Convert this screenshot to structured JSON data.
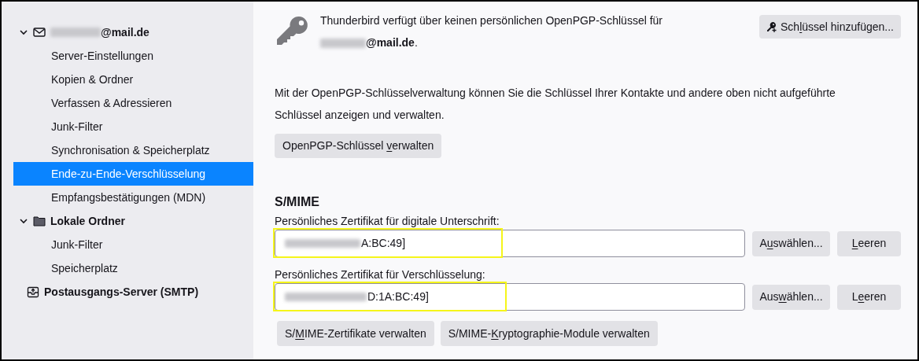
{
  "sidebar": {
    "items": [
      {
        "label": "@mail.de",
        "kind": "account",
        "expanded": true,
        "selected": false,
        "children": [
          {
            "label": "Server-Einstellungen",
            "selected": false
          },
          {
            "label": "Kopien & Ordner",
            "selected": false
          },
          {
            "label": "Verfassen & Adressieren",
            "selected": false
          },
          {
            "label": "Junk-Filter",
            "selected": false
          },
          {
            "label": "Synchronisation & Speicherplatz",
            "selected": false
          },
          {
            "label": "Ende-zu-Ende-Verschlüsselung",
            "selected": true
          },
          {
            "label": "Empfangsbestätigungen (MDN)",
            "selected": false
          }
        ]
      },
      {
        "label": "Lokale Ordner",
        "kind": "folder",
        "expanded": true,
        "selected": false,
        "children": [
          {
            "label": "Junk-Filter",
            "selected": false
          },
          {
            "label": "Speicherplatz",
            "selected": false
          }
        ]
      },
      {
        "label": "Postausgangs-Server (SMTP)",
        "kind": "outbox",
        "selected": false
      }
    ]
  },
  "openpgp": {
    "message": "Thunderbird verfügt über keinen persönlichen OpenPGP-Schlüssel für",
    "account": "**@mail.de**.",
    "add_button": {
      "label": [
        {
          "text": "Sch",
          "underlined": false
        },
        {
          "text": "l",
          "underlined": true
        },
        {
          "text": "üssel hinzufügen...",
          "underlined": false
        }
      ]
    },
    "info": "Mit der OpenPGP-Schlüsselverwaltung können Sie die Schlüssel Ihrer Kontakte und andere oben nicht aufgeführte Schlüssel anzeigen und verwalten.",
    "manage_button": {
      "label": [
        {
          "text": "OpenPGP-Schlüssel ",
          "underlined": false
        },
        {
          "text": "v",
          "underlined": true
        },
        {
          "text": "erwalten",
          "underlined": false
        }
      ]
    }
  },
  "smime": {
    "title": "S/MIME",
    "certificates": [
      {
        "label": "Persönliches Zertifikat für digitale Unterschrift:",
        "value": "A:BC:49]",
        "highlighted": true,
        "select_button": {
          "label": [
            {
              "text": "A",
              "underlined": false
            },
            {
              "text": "u",
              "underlined": true
            },
            {
              "text": "swählen...",
              "underlined": false
            }
          ]
        },
        "clear_button": {
          "label": [
            {
              "text": "L",
              "underlined": true
            },
            {
              "text": "eeren",
              "underlined": false
            }
          ]
        }
      },
      {
        "label": "Persönliches Zertifikat für Verschlüsselung:",
        "value": "D:1A:BC:49]",
        "highlighted": true,
        "select_button": {
          "label": [
            {
              "text": "Aus",
              "underlined": false
            },
            {
              "text": "w",
              "underlined": true
            },
            {
              "text": "ählen...",
              "underlined": false
            }
          ]
        },
        "clear_button": {
          "label": [
            {
              "text": "L",
              "underlined": false
            },
            {
              "text": "e",
              "underlined": true
            },
            {
              "text": "eren",
              "underlined": false
            }
          ]
        }
      }
    ],
    "buttons": [
      {
        "label": [
          {
            "text": "S/",
            "underlined": false
          },
          {
            "text": "M",
            "underlined": true
          },
          {
            "text": "IME-Zertifikate verwalten",
            "underlined": false
          }
        ]
      },
      {
        "label": [
          {
            "text": "S/MIME-",
            "underlined": false
          },
          {
            "text": "K",
            "underlined": true
          },
          {
            "text": "ryptographie-Module verwalten",
            "underlined": false
          }
        ]
      }
    ]
  }
}
